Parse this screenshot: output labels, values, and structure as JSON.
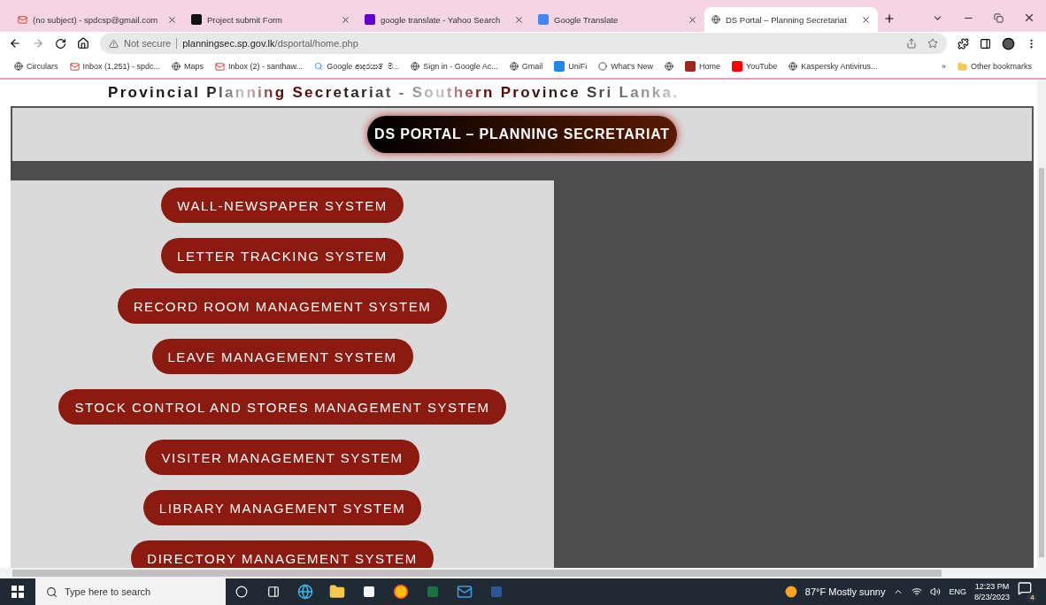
{
  "browser": {
    "tabs": [
      {
        "title": "(no subject) - spdcsp@gmail.com",
        "selected": false
      },
      {
        "title": "Project submit Form",
        "selected": false
      },
      {
        "title": "google translate - Yahoo Search",
        "selected": false
      },
      {
        "title": "Google Translate",
        "selected": false
      },
      {
        "title": "DS Portal – Planning Secretariat",
        "selected": true
      }
    ],
    "security": "Not secure",
    "url_host": "planningsec.sp.gov.lk",
    "url_path": "/dsportal/home.php",
    "bookmarks": [
      {
        "label": "Circulars"
      },
      {
        "label": "Inbox (1,251) - spdc..."
      },
      {
        "label": "Maps"
      },
      {
        "label": "Inbox (2) - santhaw..."
      },
      {
        "label": "Google ආදරයා ෙම..."
      },
      {
        "label": "Sign in - Google Ac..."
      },
      {
        "label": "Gmail"
      },
      {
        "label": "UniFi"
      },
      {
        "label": "What's New"
      },
      {
        "label": "Home"
      },
      {
        "label": "YouTube"
      },
      {
        "label": "Kaspersky Antivirus..."
      }
    ],
    "overflow": "»",
    "other_bookmarks": "Other bookmarks"
  },
  "page": {
    "site_heading": "Provincial Planning Secretariat - Southern Province Sri Lanka.",
    "portal_title": "DS PORTAL – PLANNING SECRETARIAT",
    "systems": [
      "WALL-NEWSPAPER SYSTEM",
      "LETTER TRACKING SYSTEM",
      "RECORD ROOM MANAGEMENT SYSTEM",
      "LEAVE MANAGEMENT SYSTEM",
      "STOCK CONTROL AND STORES MANAGEMENT SYSTEM",
      "VISITER MANAGEMENT SYSTEM",
      "LIBRARY MANAGEMENT SYSTEM",
      "DIRECTORY MANAGEMENT SYSTEM"
    ]
  },
  "taskbar": {
    "search_placeholder": "Type here to search",
    "weather": "87°F  Mostly sunny",
    "language": "ENG",
    "time": "12:23 PM",
    "date": "8/23/2023",
    "notifications": "4"
  }
}
